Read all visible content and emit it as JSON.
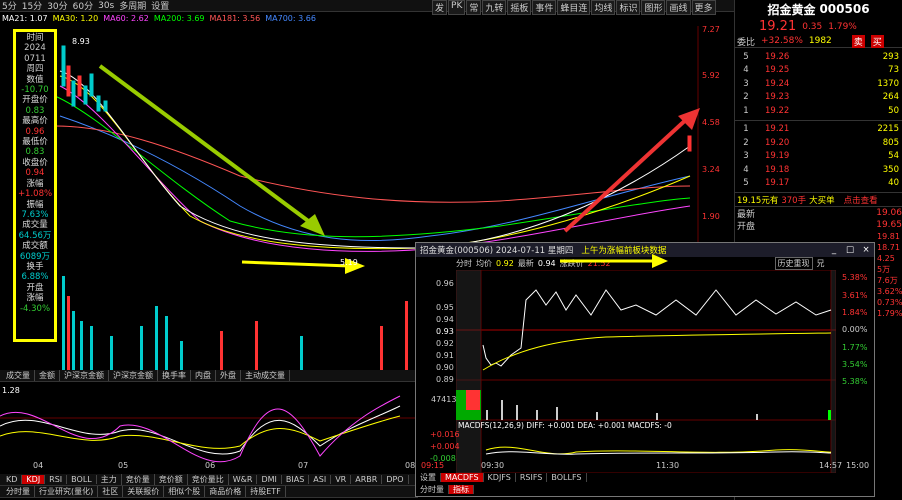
{
  "toolbar": {
    "periods": [
      "5分",
      "15分",
      "30分",
      "60分",
      "30s",
      "多周期",
      "设置"
    ],
    "menu": [
      "发",
      "PK",
      "常",
      "九转",
      "摇板",
      "事件",
      "蜂目连",
      "均线",
      "标识",
      "图形",
      "画线"
    ],
    "more": "更多",
    "list": [
      "预期"
    ]
  },
  "ma_bar": {
    "items": [
      {
        "label": "MA21: 1.07",
        "color": "#ffffff"
      },
      {
        "label": "MA30: 1.20",
        "color": "#ffff00"
      },
      {
        "label": "MA60: 2.62",
        "color": "#ff44ff"
      },
      {
        "label": "MA200: 3.69",
        "color": "#00ff00"
      },
      {
        "label": "MA181: 3.56",
        "color": "#ff5555"
      },
      {
        "label": "MA700: 3.66",
        "color": "#4488ff"
      }
    ]
  },
  "main_chart": {
    "price_high": "8.93",
    "ylabels": [
      "7.27",
      "5.92",
      "4.58",
      "3.24",
      "1.90"
    ],
    "vol_labels": [
      "88万",
      "66万",
      "44万",
      "22万"
    ],
    "low_note": "5.19",
    "xlabels": [
      "04",
      "05",
      "06",
      "07",
      "08"
    ],
    "kdj_label": "1.28"
  },
  "info_box": {
    "time_label": "时间",
    "year": "2024",
    "date": "0711",
    "weekday": "周四",
    "value_label": "数值",
    "value": "-10.70",
    "open_label": "开盘价",
    "open": "0.83",
    "high_label": "最高价",
    "high": "0.96",
    "low_label": "最低价",
    "low": "0.83",
    "close_label": "收盘价",
    "close": "0.94",
    "chg_label": "涨幅",
    "chg": "+1.08%",
    "amp_label": "振幅",
    "amp": "7.63%",
    "vol_label": "成交量",
    "vol": "64.56万",
    "amt_label": "成交额",
    "amt": "6089万",
    "turn_label": "换手",
    "turn": "6.88%",
    "open2_label": "开盘",
    "open2_chg_label": "涨幅",
    "open2_chg": "-4.30%"
  },
  "bottom_tabs1": [
    "成交量",
    "金额",
    "沪深京金额",
    "沪深京金额",
    "换手率",
    "内盘",
    "外盘",
    "主动成交量",
    "盘后成交量",
    "市盈率(ttm)",
    "市销率(ttm)",
    "特殊通达板"
  ],
  "bottom_tabs2": [
    "KD",
    "KDJ",
    "RSI",
    "BOLL",
    "主力",
    "竞价量",
    "竞价额",
    "竞价量比",
    "W&R",
    "DMI",
    "BIAS",
    "ASI",
    "VR",
    "ARBR",
    "DPO",
    "TRIX"
  ],
  "bottom_tabs3": [
    "分时量",
    "行业研究(量化)",
    "社区",
    "关联报价",
    "相似个股",
    "商品价格",
    "持股ETF"
  ],
  "right": {
    "name": "招金黄金",
    "code": "000506",
    "price": "19.21",
    "change": "0.35",
    "pct": "1.79%",
    "rank_label": "委比",
    "rank": "+32.58%",
    "rank_val": "1982",
    "sell_label": "卖",
    "buy_label": "买",
    "sell_side": "卖盘",
    "buy_side": "买盘",
    "asks": [
      {
        "n": "5",
        "p": "19.26",
        "v": "293"
      },
      {
        "n": "4",
        "p": "19.25",
        "v": "73"
      },
      {
        "n": "3",
        "p": "19.24",
        "v": "1370"
      },
      {
        "n": "2",
        "p": "19.23",
        "v": "264"
      },
      {
        "n": "1",
        "p": "19.22",
        "v": "50"
      }
    ],
    "bids": [
      {
        "n": "1",
        "p": "19.21",
        "v": "2215"
      },
      {
        "n": "2",
        "p": "19.20",
        "v": "805"
      },
      {
        "n": "3",
        "p": "19.19",
        "v": "54"
      },
      {
        "n": "4",
        "p": "19.18",
        "v": "350"
      },
      {
        "n": "5",
        "p": "19.17",
        "v": "40"
      }
    ],
    "big_order": "19.15元有",
    "big_qty": "370手",
    "big_type": "大买单",
    "big_link": "点击查看",
    "latest_label": "最新",
    "latest": "19.06",
    "kaipan_label": "开盘",
    "kaipan": "19.65",
    "right_nums": [
      "19.06",
      "19.65",
      "19.81",
      "18.71",
      "4.25",
      "5万",
      "7.6万",
      "3.62%",
      "0.73%",
      "1.79%"
    ]
  },
  "popup": {
    "title": "招金黄金(000506) 2024-07-11 星期四",
    "extra": "上午为涨幅前板块数据",
    "close_btn": "×",
    "max_btn": "□",
    "min_btn": "_",
    "header": {
      "label": "分时",
      "avg": "均价",
      "avg_val": "0.92",
      "latest": "最新",
      "latest_val": "0.94",
      "chg": "涨跌价",
      "chg_val": "21.52",
      "history": "历史重现",
      "back": "兄"
    },
    "yl": [
      "0.96",
      "0.95",
      "0.94",
      "0.93",
      "0.92",
      "0.91",
      "0.90",
      "0.89"
    ],
    "yr": [
      "5.38%",
      "3.61%",
      "1.84%",
      "0.00%",
      "1.77%",
      "3.54%",
      "5.38%"
    ],
    "vol_label": "47413",
    "macd_label": "MACDFS(12,26,9) DIFF: +0.001 DEA: +0.001 MACDFS: -0",
    "macd_y": [
      "+0.016",
      "+0.004",
      "-0.008"
    ],
    "times": [
      "09:15",
      "09:30",
      "11:30",
      "14:57",
      "15:00"
    ],
    "tabs1": [
      "设置",
      "MACDFS",
      "KDJFS",
      "RSIFS",
      "BOLLFS"
    ],
    "tabs2": [
      "分时量",
      "指标"
    ]
  }
}
